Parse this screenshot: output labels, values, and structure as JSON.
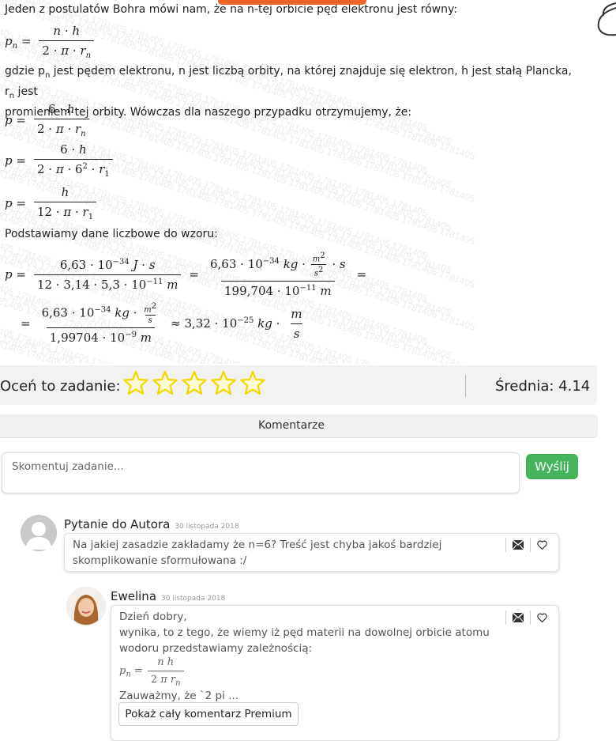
{
  "watermark": "1781405",
  "article": {
    "intro": "Jeden z postulatów Bohra mówi nam, że na n-tej orbicie pęd elektronu jest równy:",
    "gdzie_prefix": "gdzie p",
    "gdzie_sub": "n",
    "gdzie_mid": " jest pędem elektronu, n jest liczbą orbity, na której znajduje się elektron, h jest stałą Plancka, r",
    "gdzie_sub2": "n",
    "gdzie_suffix": " jest",
    "gdzie_line2": "promieniem tej orbity. Wówczas dla naszego przypadku otrzymujemy, że:",
    "subst": "Podstawiamy dane liczbowe do wzoru:",
    "num_val": "6,63 · 10",
    "exp_34": "−34",
    "den1": "12 · 3,14 · 5,3 · 10",
    "exp_11": "−11",
    "den2": "199,704 · 10",
    "den3": "1,99704 · 10",
    "exp_9": "−9",
    "result": "≈ 3,32 · 10",
    "exp_25": "−25"
  },
  "rating": {
    "label": "Oceń to zadanie:",
    "stars": 5,
    "average_label": "Średnia: 4.14",
    "star_color": "#f5d800"
  },
  "comments": {
    "title": "Komentarze",
    "input_placeholder": "Skomentuj zadanie...",
    "send_label": "Wyślij",
    "items": [
      {
        "author": "Pytanie do Autora",
        "date": "30 listopada 2018",
        "lines": [
          "Na jakiej zasadzie zakładamy że n=6? Treść jest chyba jakoś bardziej",
          "skomplikowanie sformułowana :/"
        ]
      },
      {
        "author": "Ewelina",
        "date": "30 listopada 2018",
        "lines": [
          "Dzień dobry,",
          "wynika, to z tego, że wiemy iż pęd materii na dowolnej orbicie atomu",
          "wodoru przedstawiamy zależnością:"
        ],
        "tail": "Zauważmy, że `2  pi ...",
        "premium_label": "Pokaż cały komentarz Premium"
      }
    ]
  },
  "colors": {
    "accent_orange": "#f0642a",
    "send_green": "#44b35a"
  }
}
